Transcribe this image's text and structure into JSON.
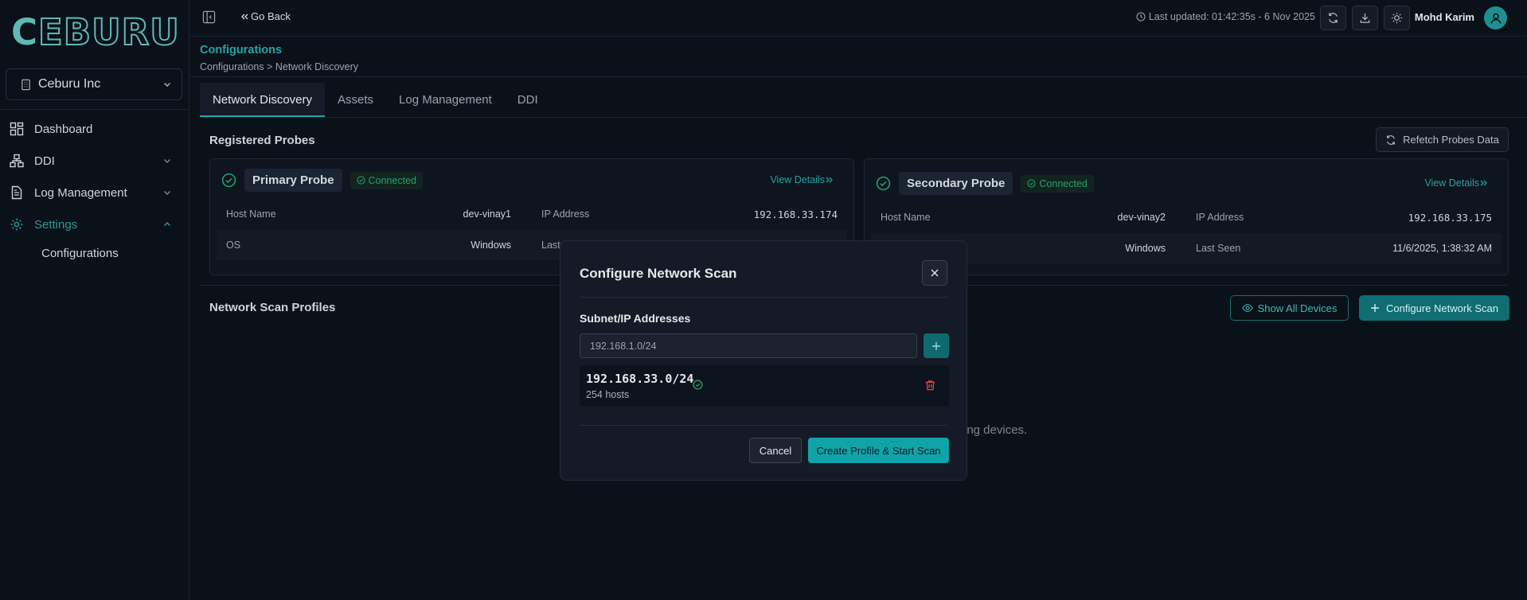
{
  "app": {
    "logo_text": "CEBURU",
    "org_name": "Ceburu Inc"
  },
  "colors": {
    "accent": "#24a3a3",
    "success": "#21a36a",
    "danger": "#e5484d",
    "background": "#0b1119"
  },
  "sidebar": {
    "items": [
      {
        "label": "Dashboard",
        "icon": "dashboard-icon"
      },
      {
        "label": "DDI",
        "icon": "network-icon"
      },
      {
        "label": "Log Management",
        "icon": "document-icon"
      },
      {
        "label": "Settings",
        "icon": "gear-icon"
      }
    ],
    "sub_item": "Configurations"
  },
  "header": {
    "go_back": "Go Back",
    "last_updated": "Last updated: 01:42:35s - 6 Nov 2025",
    "user_name": "Mohd Karim"
  },
  "page": {
    "title": "Configurations",
    "breadcrumb": "Configurations > Network Discovery",
    "tabs": [
      {
        "label": "Network Discovery",
        "active": true
      },
      {
        "label": "Assets",
        "active": false
      },
      {
        "label": "Log Management",
        "active": false
      },
      {
        "label": "DDI",
        "active": false
      }
    ]
  },
  "probes": {
    "section_title": "Registered Probes",
    "refetch_label": "Refetch Probes Data",
    "view_details": "View Details",
    "cards": [
      {
        "name": "Primary Probe",
        "status": "Connected",
        "host_name_label": "Host Name",
        "host_name": "dev-vinay1",
        "ip_label": "IP Address",
        "ip": "192.168.33.174",
        "os_label": "OS",
        "os": "Windows",
        "last_seen_label": "Last"
      },
      {
        "name": "Secondary Probe",
        "status": "Connected",
        "host_name_label": "Host Name",
        "host_name": "dev-vinay2",
        "ip_label": "IP Address",
        "ip": "192.168.33.175",
        "os": "Windows",
        "last_seen_label": "Last Seen",
        "last_seen": "11/6/2025, 1:38:32 AM"
      }
    ]
  },
  "scan_profiles": {
    "section_title": "Network Scan Profiles",
    "show_all_label": "Show All Devices",
    "configure_label": "Configure Network Scan",
    "empty_text": "ring devices."
  },
  "modal": {
    "title": "Configure Network Scan",
    "field_label": "Subnet/IP Addresses",
    "input_placeholder": "192.168.1.0/24",
    "subnets": [
      {
        "address": "192.168.33.0/24",
        "hosts": "254 hosts"
      }
    ],
    "cancel_label": "Cancel",
    "submit_label": "Create Profile & Start Scan"
  }
}
